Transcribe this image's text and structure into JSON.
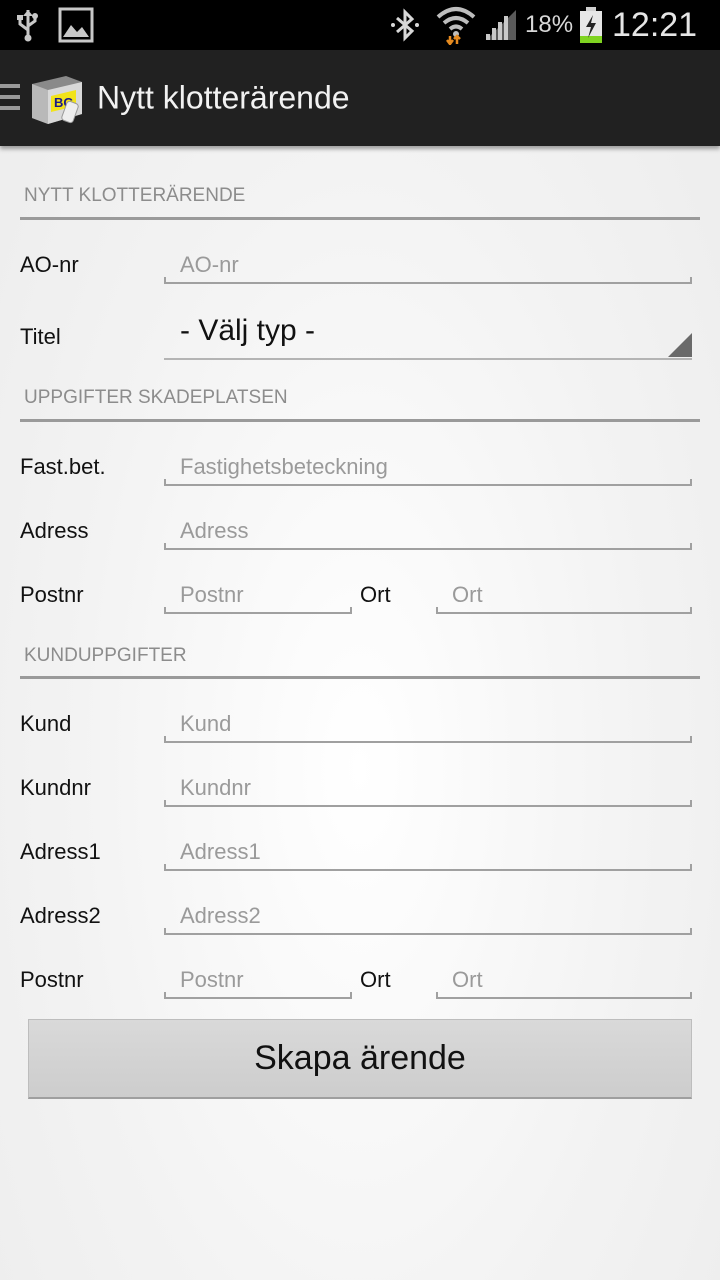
{
  "status_bar": {
    "battery_percent": "18%",
    "time": "12:21",
    "icons": [
      "usb-icon",
      "image-icon",
      "bluetooth-icon",
      "wifi-icon",
      "signal-icon",
      "battery-charging-icon"
    ]
  },
  "action_bar": {
    "title": "Nytt klotterärende",
    "logo_icon": "app-logo-icon",
    "menu_icon": "hamburger-menu-icon"
  },
  "section_new": {
    "header": "NYTT KLOTTERÄRENDE",
    "ao_label": "AO-nr",
    "ao_placeholder": "AO-nr",
    "ao_value": "",
    "title_label": "Titel",
    "title_selected": "- Välj typ -"
  },
  "section_location": {
    "header": "UPPGIFTER SKADEPLATSEN",
    "fastbet_label": "Fast.bet.",
    "fastbet_placeholder": "Fastighetsbeteckning",
    "adress_label": "Adress",
    "adress_placeholder": "Adress",
    "postnr_label": "Postnr",
    "postnr_placeholder": "Postnr",
    "ort_label": "Ort",
    "ort_placeholder": "Ort"
  },
  "section_customer": {
    "header": "KUNDUPPGIFTER",
    "kund_label": "Kund",
    "kund_placeholder": "Kund",
    "kundnr_label": "Kundnr",
    "kundnr_placeholder": "Kundnr",
    "adress1_label": "Adress1",
    "adress1_placeholder": "Adress1",
    "adress2_label": "Adress2",
    "adress2_placeholder": "Adress2",
    "postnr_label": "Postnr",
    "postnr_placeholder": "Postnr",
    "ort_label": "Ort",
    "ort_placeholder": "Ort"
  },
  "create_button_label": "Skapa ärende",
  "colors": {
    "action_bar": "#212121",
    "status_bar": "#000000",
    "battery_fill": "#7fd321",
    "rule": "#9a9a9a"
  }
}
